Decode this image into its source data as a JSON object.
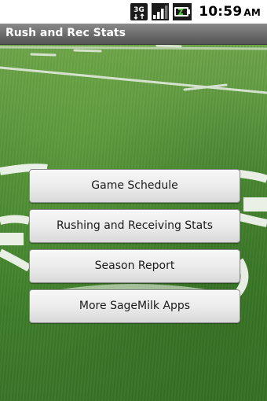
{
  "status_bar": {
    "network_label": "3G",
    "time": "10:59",
    "ampm": "AM",
    "icons": [
      "network-3g-icon",
      "signal-strength-icon",
      "battery-icon"
    ]
  },
  "app": {
    "title": "Rush and Rec Stats"
  },
  "menu": {
    "buttons": [
      {
        "label": "Game Schedule"
      },
      {
        "label": "Rushing and Receiving Stats"
      },
      {
        "label": "Season Report"
      },
      {
        "label": "More SageMilk Apps"
      }
    ]
  },
  "colors": {
    "title_bar": "#6b6b6b",
    "field_green": "#4f8e35",
    "field_lines": "#ffffff"
  }
}
